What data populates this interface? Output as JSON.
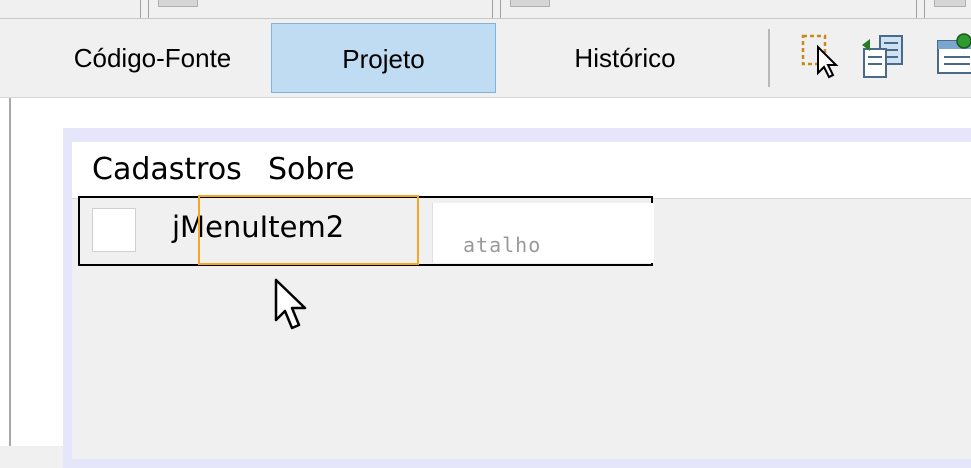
{
  "tabs": [
    {
      "label": "Código-Fonte",
      "active": false
    },
    {
      "label": "Projeto",
      "active": true
    },
    {
      "label": "Histórico",
      "active": false
    }
  ],
  "toolbar_icons": [
    "selection-mode-icon",
    "connection-mode-icon",
    "preview-design-icon"
  ],
  "menubar": {
    "items": [
      "Cadastros",
      "Sobre"
    ]
  },
  "menu_item": {
    "text": "jMenuItem2",
    "shortcut_placeholder": "atalho",
    "checked": false
  },
  "colors": {
    "active_tab": "#bfdcf2",
    "selection_outline": "#f5a623",
    "form_frame": "#e6e6fb"
  }
}
